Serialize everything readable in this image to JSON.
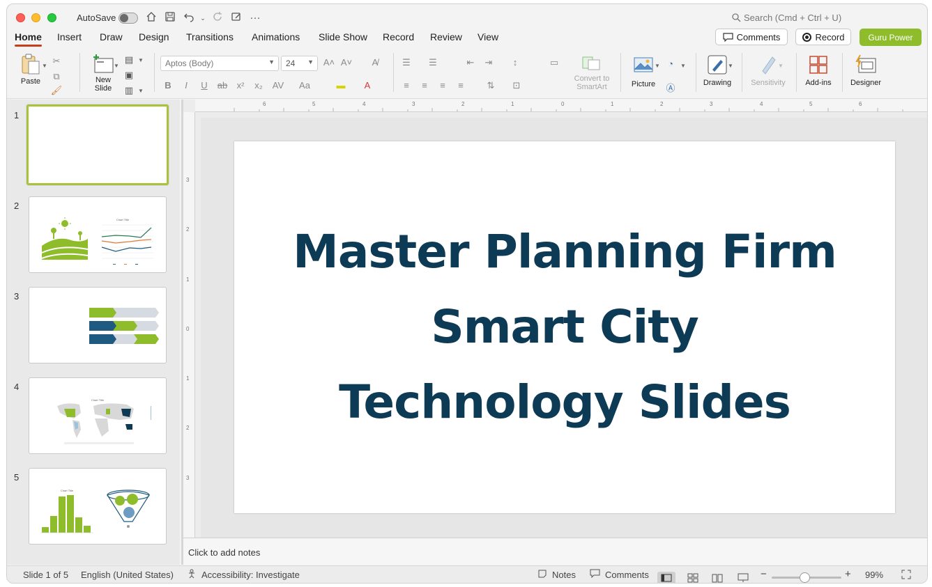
{
  "titlebar": {
    "autosave_label": "AutoSave",
    "search_placeholder": "Search (Cmd + Ctrl + U)"
  },
  "tabs": [
    "Home",
    "Insert",
    "Draw",
    "Design",
    "Transitions",
    "Animations",
    "Slide Show",
    "Record",
    "Review",
    "View"
  ],
  "header_buttons": {
    "comments": "Comments",
    "record": "Record",
    "guru": "Guru Power"
  },
  "ribbon": {
    "paste": "Paste",
    "new_slide": "New Slide",
    "font_name": "Aptos (Body)",
    "font_size": "24",
    "convert_smartart": "Convert to SmartArt",
    "picture": "Picture",
    "drawing": "Drawing",
    "sensitivity": "Sensitivity",
    "addins": "Add-ins",
    "designer": "Designer"
  },
  "thumbnails": [
    {
      "num": "1"
    },
    {
      "num": "2",
      "chart_title": "Chart Title"
    },
    {
      "num": "3"
    },
    {
      "num": "4",
      "chart_title": "Chart Title"
    },
    {
      "num": "5",
      "chart_title": "Chart Title"
    }
  ],
  "ruler": {
    "h": [
      "6",
      "5",
      "4",
      "3",
      "2",
      "1",
      "0",
      "1",
      "2",
      "3",
      "4",
      "5",
      "6"
    ],
    "v": [
      "3",
      "2",
      "1",
      "0",
      "1",
      "2",
      "3"
    ]
  },
  "slide": {
    "line1": "Master Planning Firm",
    "line2": "Smart City",
    "line3": "Technology Slides"
  },
  "notes_placeholder": "Click to add notes",
  "status": {
    "slide_count": "Slide 1 of 5",
    "language": "English (United States)",
    "accessibility": "Accessibility: Investigate",
    "notes": "Notes",
    "comments": "Comments",
    "zoom": "99%"
  },
  "colors": {
    "accent_red": "#c43e1c",
    "guru_green": "#8fbc2b",
    "title_navy": "#0d3a55",
    "thumb_green": "#8fbc2b",
    "thumb_navy": "#1f5b80"
  }
}
